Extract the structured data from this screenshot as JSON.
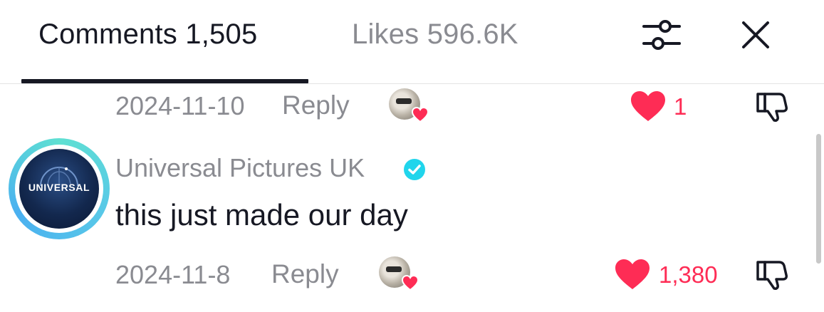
{
  "header": {
    "comments_tab": "Comments 1,505",
    "likes_tab": "Likes 596.6K"
  },
  "comments": [
    {
      "date": "2024-11-10",
      "reply_label": "Reply",
      "like_count": "1"
    },
    {
      "author": "Universal Pictures UK",
      "avatar_text": "UNIVERSAL",
      "verified": true,
      "text": "this just made our day",
      "date": "2024-11-8",
      "reply_label": "Reply",
      "like_count": "1,380"
    }
  ],
  "colors": {
    "like_red": "#fe2c55",
    "verified_blue": "#20d5ec",
    "muted_text": "#8a8b91",
    "primary_text": "#161823"
  },
  "icons": {
    "filter": "sliders-icon",
    "close": "close-icon",
    "like": "heart-icon",
    "dislike": "thumbs-down-icon",
    "verified": "verified-badge-icon"
  }
}
